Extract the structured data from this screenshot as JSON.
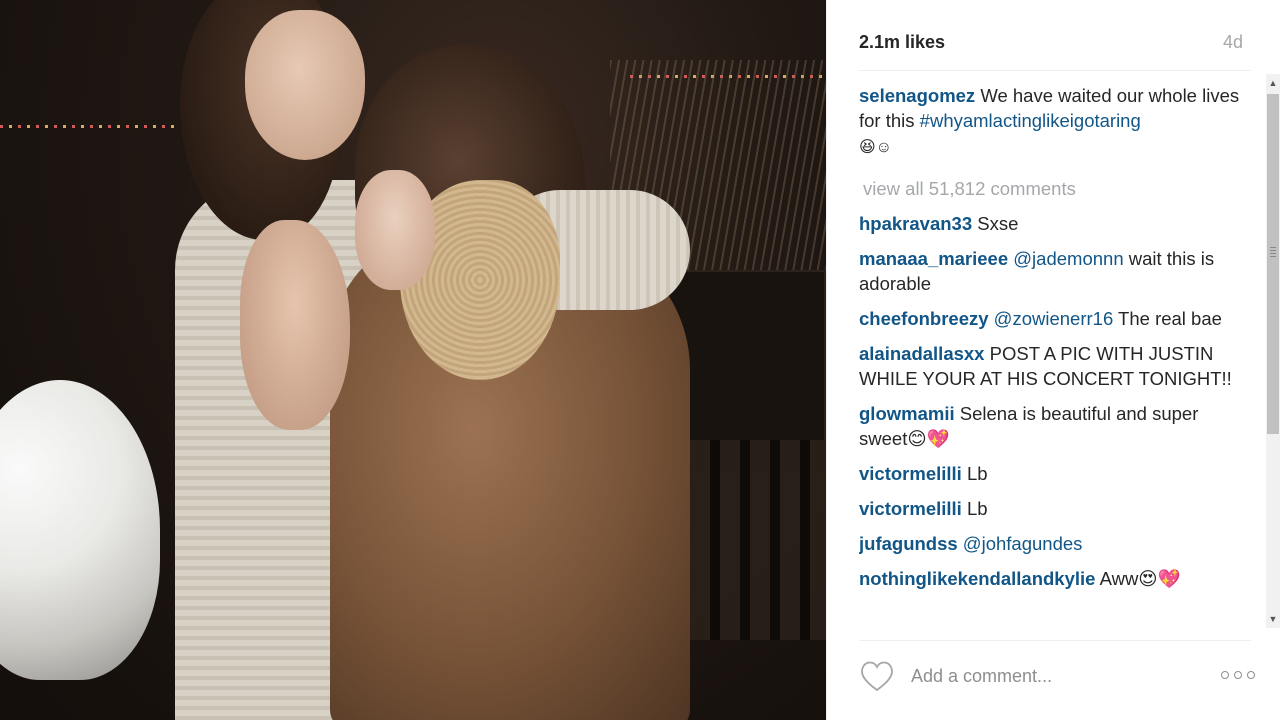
{
  "post": {
    "likes": "2.1m likes",
    "age": "4d",
    "caption": {
      "user": "selenagomez",
      "text": " We have waited our whole lives for this ",
      "hashtag": "#whyamlactinglikeigotaring",
      "emoji": "😆☺"
    },
    "view_all": "view all 51,812 comments"
  },
  "comments": [
    {
      "user": "hpakravan33",
      "mention": "",
      "text": " Sxse"
    },
    {
      "user": "manaaa_marieee",
      "mention": " @jademonnn",
      "text": " wait this is adorable"
    },
    {
      "user": "cheefonbreezy",
      "mention": " @zowienerr16",
      "text": " The real bae"
    },
    {
      "user": "alainadallasxx",
      "mention": "",
      "text": " POST A PIC WITH JUSTIN WHILE YOUR AT HIS CONCERT TONIGHT!!"
    },
    {
      "user": "glowmamii",
      "mention": "",
      "text": " Selena is beautiful and super sweet😊💖"
    },
    {
      "user": "victormelilli",
      "mention": "",
      "text": " Lb"
    },
    {
      "user": "victormelilli",
      "mention": "",
      "text": " Lb"
    },
    {
      "user": "jufagundss",
      "mention": " @johfagundes",
      "text": ""
    },
    {
      "user": "nothinglikekendallandkylie",
      "mention": "",
      "text": " Aww😍💖"
    }
  ],
  "composer": {
    "placeholder": "Add a comment..."
  },
  "icons": {
    "like": "heart-icon",
    "more": "more-options-icon"
  }
}
